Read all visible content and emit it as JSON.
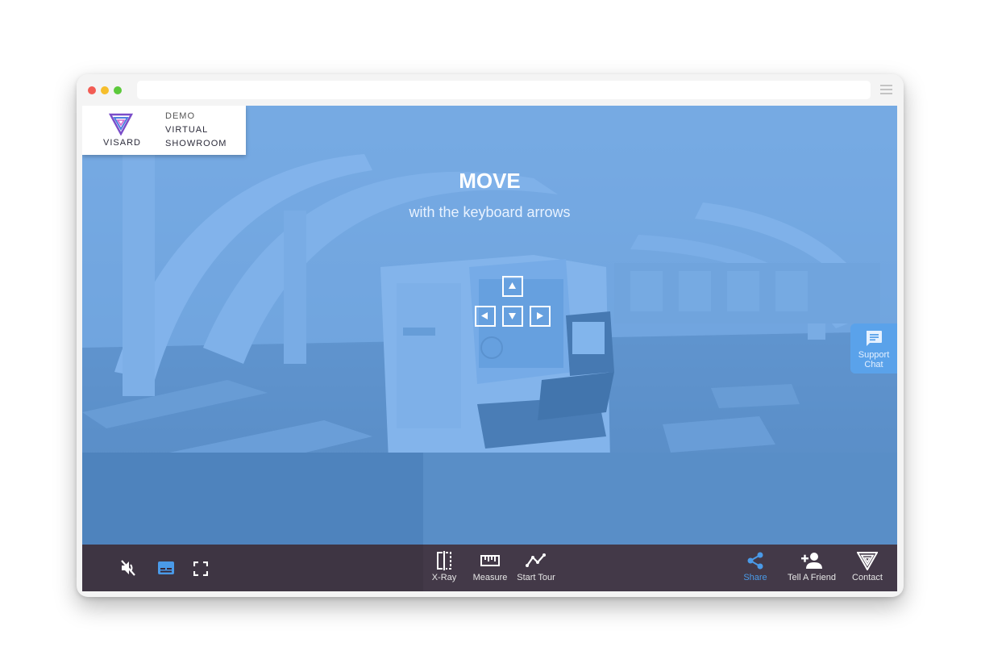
{
  "logo": {
    "brand": "VISARD",
    "line1": "DEMO",
    "line2": "VIRTUAL",
    "line3": "SHOWROOM"
  },
  "hint": {
    "title": "MOVE",
    "subtitle": "with the keyboard arrows"
  },
  "support": {
    "line1": "Support",
    "line2": "Chat"
  },
  "toolbar": {
    "xray": "X-Ray",
    "measure": "Measure",
    "tour": "Start Tour",
    "share": "Share",
    "friend": "Tell A Friend",
    "contact": "Contact"
  },
  "icons": [
    "mute-icon",
    "subtitles-icon",
    "fullscreen-icon",
    "xray-icon",
    "ruler-icon",
    "tour-icon",
    "share-icon",
    "add-person-icon",
    "visard-logo-icon",
    "chat-icon",
    "arrow-up-icon",
    "arrow-left-icon",
    "arrow-down-icon",
    "arrow-right-icon"
  ],
  "colors": {
    "overlay": "#4492e6",
    "toolbar": "#372837",
    "active": "#4a9ae8",
    "support": "#5aa2ea"
  }
}
